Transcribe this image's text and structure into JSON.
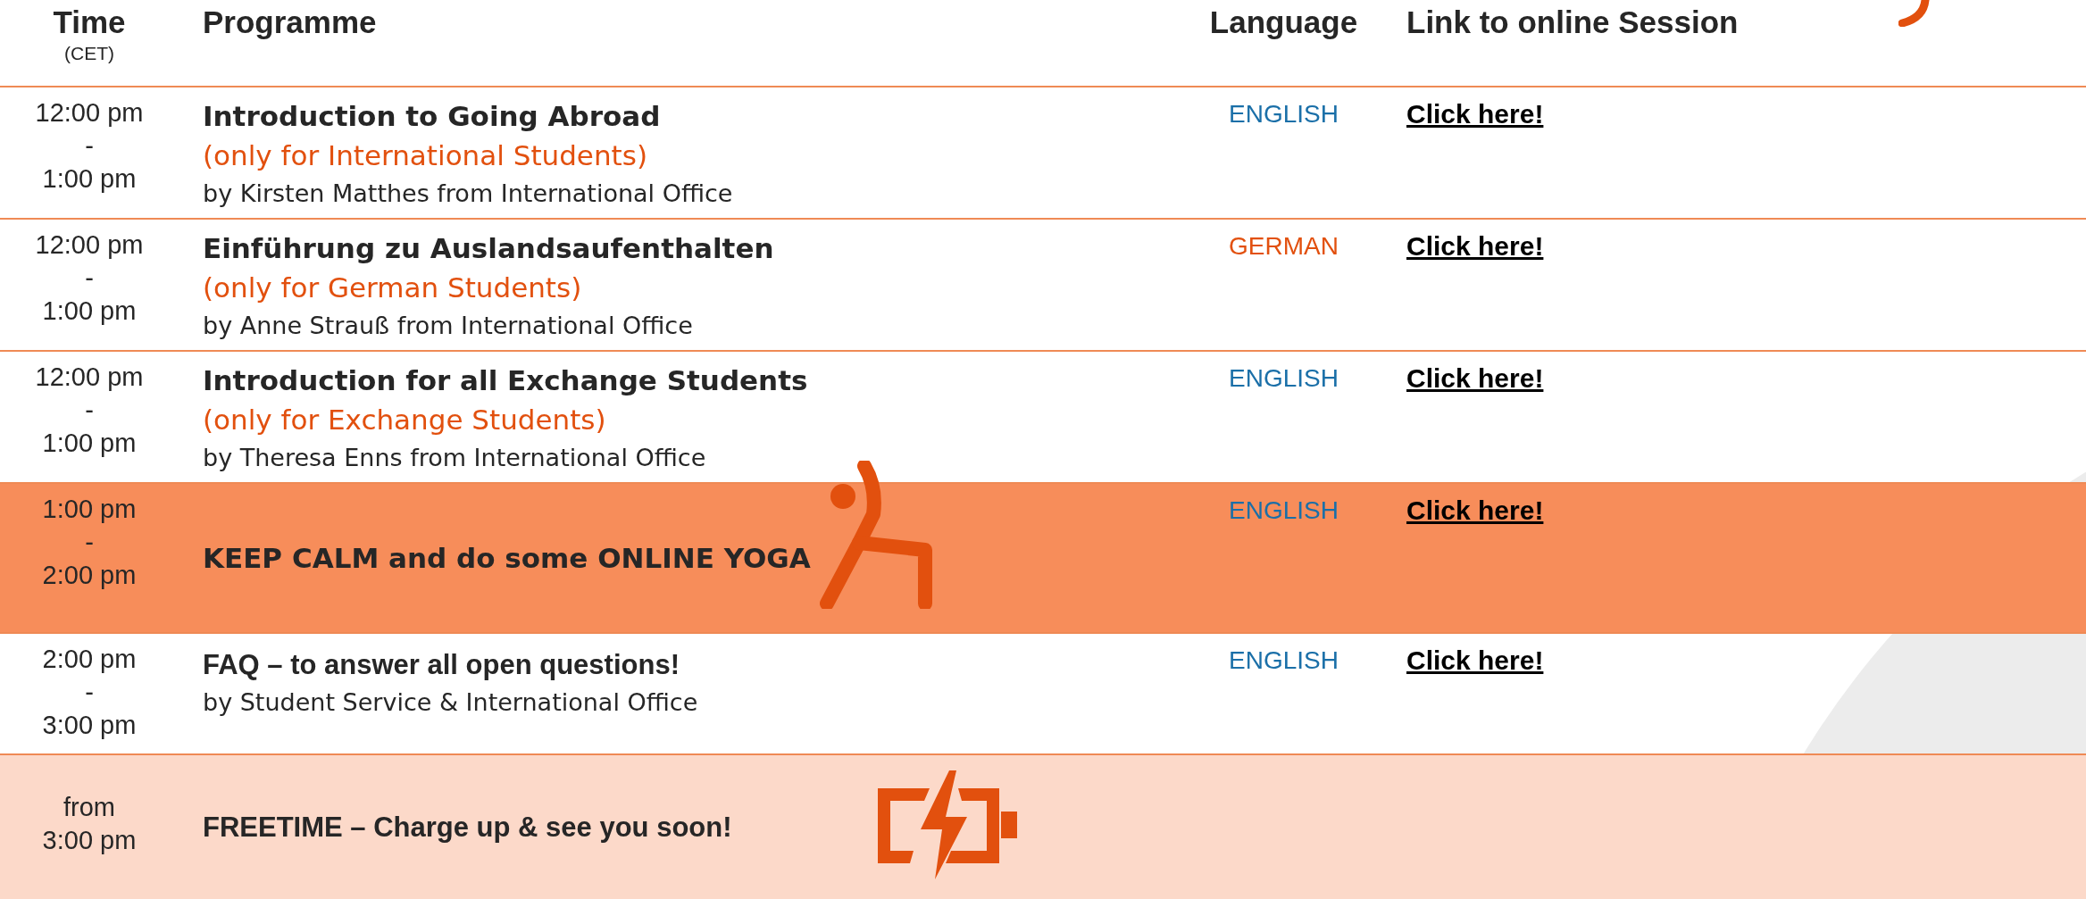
{
  "header": {
    "time": "Time",
    "time_note": "(CET)",
    "programme": "Programme",
    "language": "Language",
    "link": "Link to online Session"
  },
  "rows": [
    {
      "kind": "session",
      "time": [
        "12:00 pm",
        "-",
        "1:00 pm"
      ],
      "title": "Introduction to Going Abroad",
      "note": "(only for International Students)",
      "by": "by Kirsten Matthes from International Office",
      "language": "ENGLISH",
      "color": "#1a6fa8",
      "link": "Click here!"
    },
    {
      "kind": "session",
      "time": [
        "12:00 pm",
        "-",
        "1:00 pm"
      ],
      "title": "Einführung zu Auslandsaufenthalten",
      "note": "(only for German Students)",
      "by": "by Anne Strauß from International Office",
      "language": "GERMAN",
      "color": "#e2500e",
      "link": "Click here!"
    },
    {
      "kind": "session",
      "time": [
        "12:00 pm",
        "-",
        "1:00 pm"
      ],
      "title": "Introduction for all Exchange Students",
      "note": "(only for Exchange Students)",
      "by": "by Theresa Enns from International Office",
      "language": "ENGLISH",
      "color": "#1a6fa8",
      "link": "Click here!"
    },
    {
      "kind": "yoga",
      "time": [
        "1:00 pm",
        "-",
        "2:00 pm"
      ],
      "title": "KEEP CALM and do some ONLINE YOGA",
      "language": "ENGLISH",
      "color": "#1a6fa8",
      "link": "Click here!"
    },
    {
      "kind": "faq",
      "time": [
        "2:00 pm",
        "-",
        "3:00 pm"
      ],
      "title": "FAQ – to answer all open questions!",
      "by": "by Student Service & International Office",
      "language": "ENGLISH",
      "color": "#1a6fa8",
      "link": "Click here!"
    },
    {
      "kind": "freetime",
      "time": [
        "from",
        "3:00 pm"
      ],
      "title": "FREETIME – Charge up & see you soon!"
    }
  ]
}
